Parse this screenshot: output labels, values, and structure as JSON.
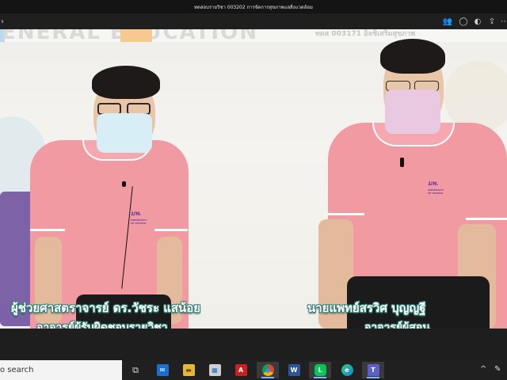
{
  "window": {
    "title": "ทดสอบรายวิชา 003202 การจัดการสุขภาพแลสิ่งแวดล้อม"
  },
  "toolbar": {
    "icons": [
      "people-icon",
      "chat-icon",
      "reactions-icon",
      "share-icon",
      "more-icon"
    ]
  },
  "banner": {
    "left_text": "ENERAL EDUCATION",
    "right_text": "ทดส 003171 อิลชิเสริมสุขภาพ"
  },
  "captions": {
    "left_name": "ผู้ช่วยศาสตราจารย์ ดร.วัชระ แสน้อย",
    "left_role": "อาจารย์ผู้รับผิดชอบรายวิชา",
    "right_name": "นายแพทย์สรวิศ บุญญฐี",
    "right_role": "อาจารย์ผู้สอน"
  },
  "shirt_logo": {
    "text": "มพ.",
    "sub": "UNIVERSITY OF PHAYAO"
  },
  "taskbar": {
    "search_text": "o search",
    "apps": [
      {
        "name": "task-view",
        "glyph": "⧉"
      },
      {
        "name": "mail",
        "glyph": "✉"
      },
      {
        "name": "file-explorer",
        "glyph": "▬"
      },
      {
        "name": "store",
        "glyph": "▦"
      },
      {
        "name": "acrobat",
        "glyph": "A"
      },
      {
        "name": "chrome",
        "glyph": "●"
      },
      {
        "name": "word",
        "glyph": "W"
      },
      {
        "name": "line",
        "glyph": "L"
      },
      {
        "name": "edge",
        "glyph": "e"
      },
      {
        "name": "teams",
        "glyph": "T"
      }
    ],
    "tray": [
      "^",
      "✎"
    ]
  },
  "colors": {
    "shirt": "#f29aa2",
    "logo": "#6a3ea0",
    "caption_outline": "#2f7d73",
    "taskbar": "#202020"
  }
}
